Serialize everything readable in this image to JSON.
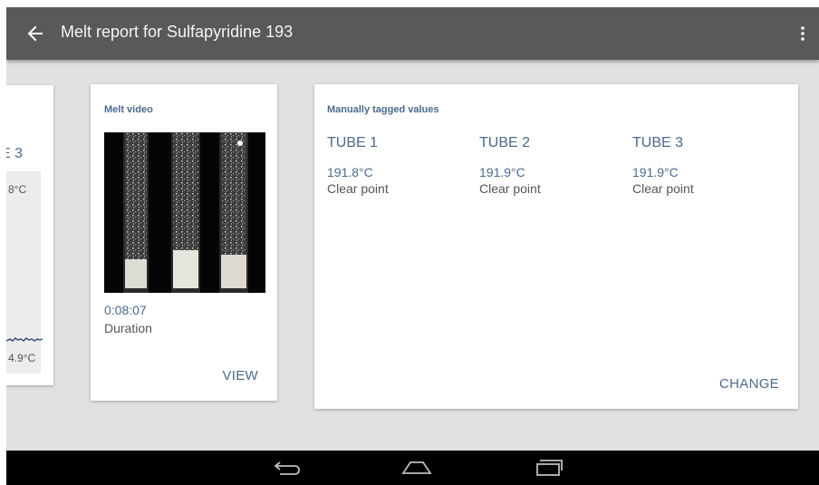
{
  "app_bar": {
    "title": "Melt report for Sulfapyridine 193",
    "back_icon": "arrow-left-icon",
    "menu_icon": "more-vertical-icon",
    "color": "#58595b"
  },
  "partial_card": {
    "heading": "E 3",
    "max_value": "8°C",
    "min_value": "4.9°C"
  },
  "video_card": {
    "label": "Melt video",
    "duration": "0:08:07",
    "duration_label": "Duration",
    "action": "VIEW"
  },
  "tagged_card": {
    "label": "Manually tagged values",
    "tubes": [
      {
        "name": "TUBE 1",
        "temp": "191.8°C",
        "type": "Clear point"
      },
      {
        "name": "TUBE 2",
        "temp": "191.9°C",
        "type": "Clear point"
      },
      {
        "name": "TUBE 3",
        "temp": "191.9°C",
        "type": "Clear point"
      }
    ],
    "action": "CHANGE"
  },
  "nav_bar": {
    "icons": [
      "back-icon",
      "home-icon",
      "recent-apps-icon"
    ]
  },
  "colors": {
    "accent": "#4a6a8c",
    "background": "#e1e1e1",
    "nav_bar": "#000000"
  }
}
